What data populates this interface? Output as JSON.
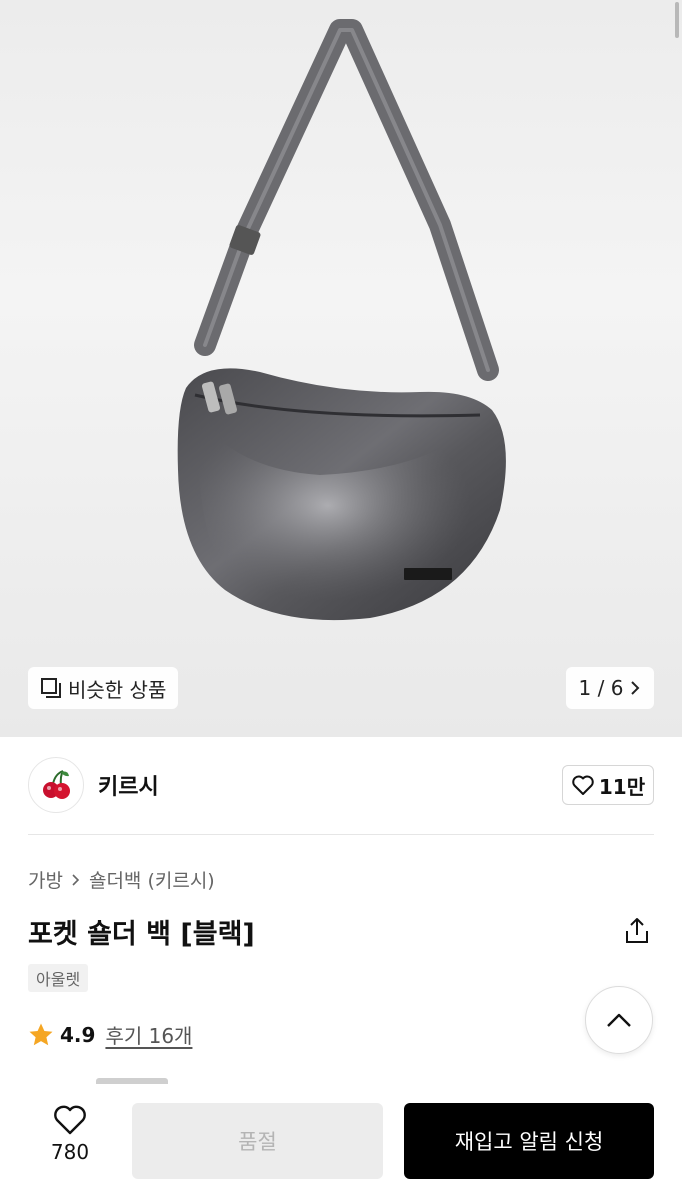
{
  "hero": {
    "similar_label": "비슷한 상품",
    "counter": "1 / 6"
  },
  "brand": {
    "name": "키르시",
    "likes": "11만"
  },
  "breadcrumb": {
    "category": "가방",
    "subcategory": "숄더백 (키르시)"
  },
  "product": {
    "title": "포켓 숄더 백 [블랙]",
    "tag": "아울렛",
    "rating": "4.9",
    "reviews": "후기 16개"
  },
  "bottom": {
    "wish_count": "780",
    "soldout_label": "품절",
    "notify_label": "재입고 알림 신청"
  },
  "colors": {
    "accent_star": "#f5a623",
    "primary_button": "#000000",
    "disabled_button": "#ececec"
  }
}
